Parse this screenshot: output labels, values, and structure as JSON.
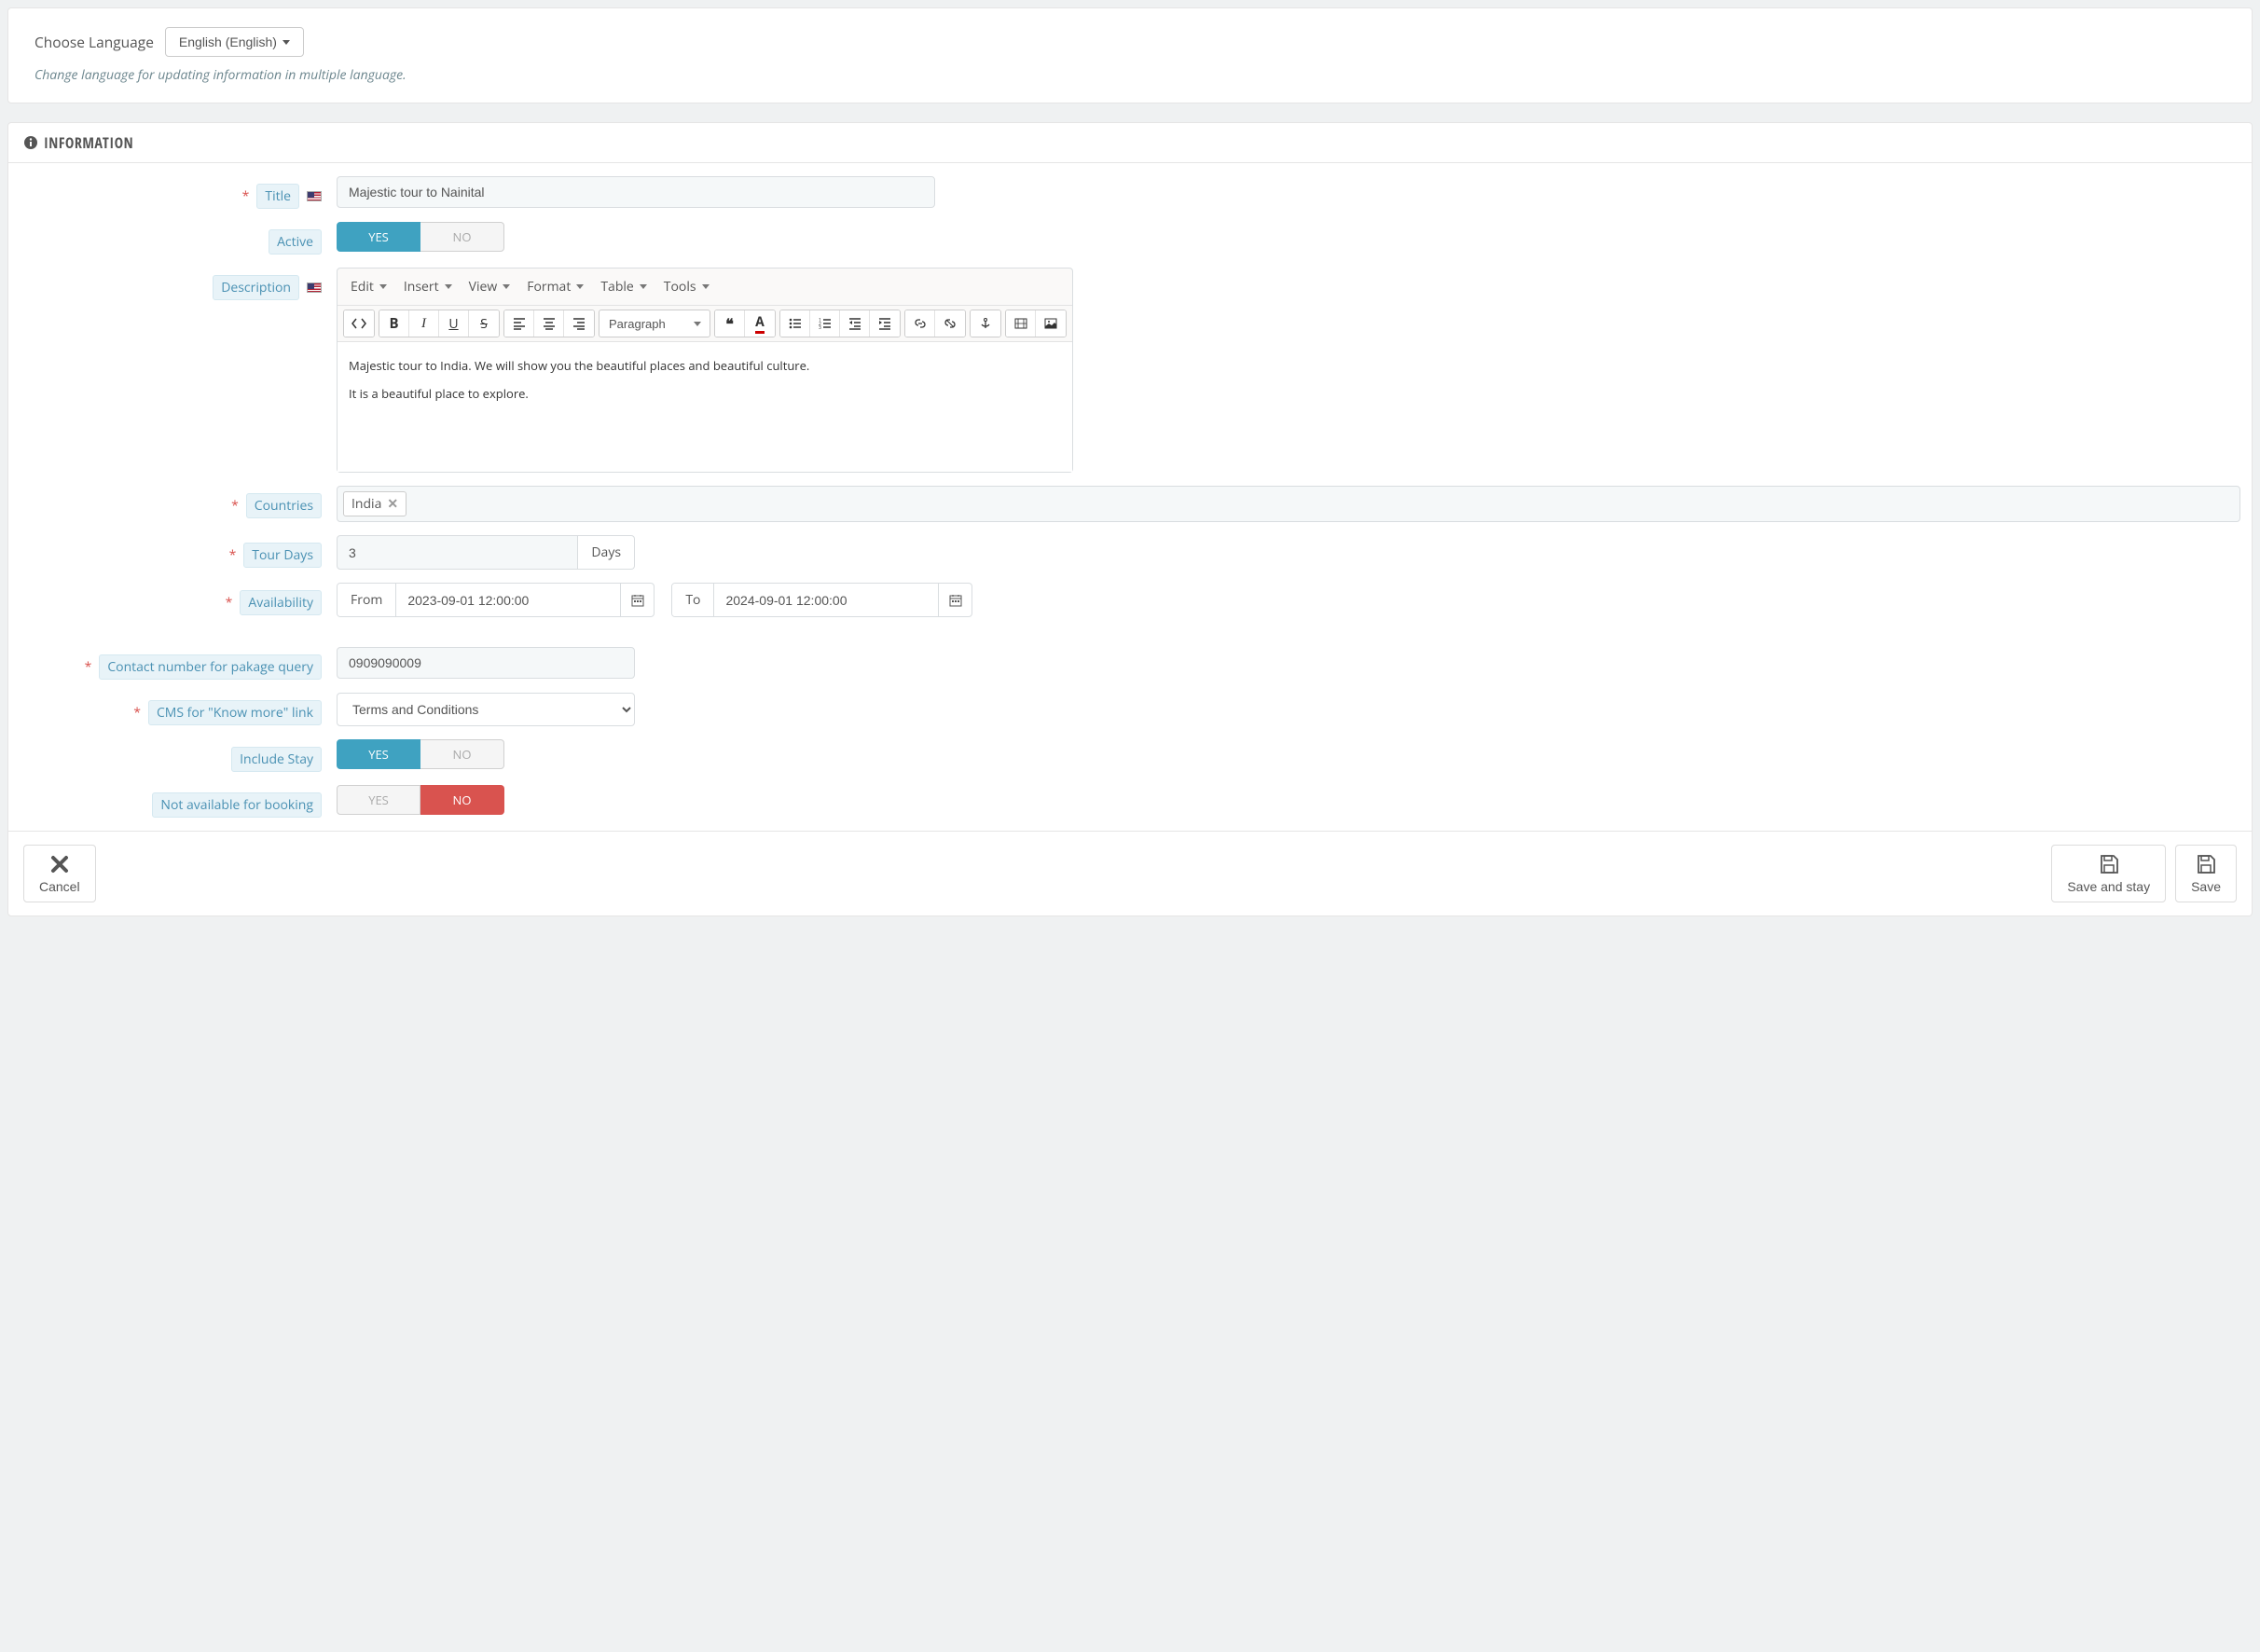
{
  "language_panel": {
    "label": "Choose Language",
    "dropdown_value": "English (English)",
    "help_text": "Change language for updating information in multiple language."
  },
  "info_panel": {
    "heading": "INFORMATION",
    "fields": {
      "title": {
        "label": "Title",
        "value": "Majestic tour to Nainital"
      },
      "active": {
        "label": "Active",
        "yes": "YES",
        "no": "NO"
      },
      "description": {
        "label": "Description",
        "menubar": {
          "edit": "Edit",
          "insert": "Insert",
          "view": "View",
          "format": "Format",
          "table": "Table",
          "tools": "Tools"
        },
        "block_format": "Paragraph",
        "content_line1": "Majestic tour to India. We will show you the beautiful places and beautiful culture.",
        "content_line2": "It is a beautiful place to explore."
      },
      "countries": {
        "label": "Countries",
        "tag": "India"
      },
      "tour_days": {
        "label": "Tour Days",
        "value": "3",
        "suffix": "Days"
      },
      "availability": {
        "label": "Availability",
        "from_label": "From",
        "from_value": "2023-09-01 12:00:00",
        "to_label": "To",
        "to_value": "2024-09-01 12:00:00"
      },
      "contact": {
        "label": "Contact number for pakage query",
        "value": "0909090009"
      },
      "cms": {
        "label": "CMS for \"Know more\" link",
        "value": "Terms and Conditions"
      },
      "include_stay": {
        "label": "Include Stay",
        "yes": "YES",
        "no": "NO"
      },
      "not_available": {
        "label": "Not available for booking",
        "yes": "YES",
        "no": "NO"
      }
    }
  },
  "footer": {
    "cancel": "Cancel",
    "save_stay": "Save and stay",
    "save": "Save"
  }
}
